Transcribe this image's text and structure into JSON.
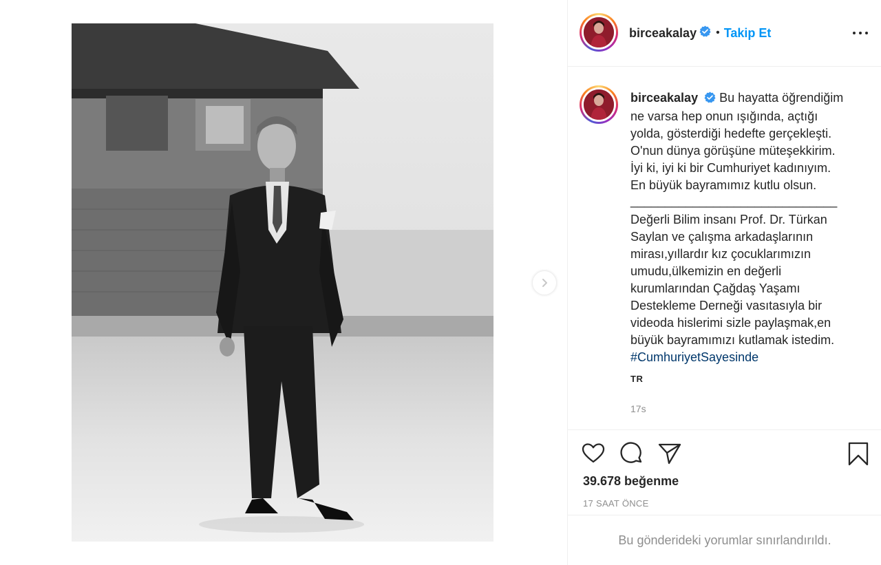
{
  "post": {
    "username": "birceakalay",
    "verified": true,
    "dot": "•",
    "follow_label": "Takip Et",
    "more_icon": "more-horizontal-icon"
  },
  "media": {
    "next_icon": "chevron-right-icon",
    "alt": "Black and white photograph"
  },
  "caption": {
    "username": "birceakalay",
    "lines": [
      "Bu hayatta öğrendiğim",
      "ne varsa hep onun ışığında, açtığı",
      "yolda, gösterdiği hedefte gerçekleşti.",
      "O'nun dünya görüşüne müteşekkirim.",
      "İyi ki, iyi ki bir Cumhuriyet kadınıyım.",
      "En büyük bayramımız kutlu olsun.",
      "______________________________",
      "Değerli Bilim insanı Prof. Dr. Türkan",
      "Saylan ve çalışma arkadaşlarının",
      "mirası,yıllardır kız çocuklarımızın",
      "umudu,ülkemizin en değerli",
      "kurumlarından Çağdaş Yaşamı",
      "Destekleme Derneği vasıtasıyla bir",
      "videoda hislerimi sizle paylaşmak,en",
      "büyük bayramımızı kutlamak istedim."
    ],
    "hashtag": "#CumhuriyetSayesinde",
    "translate": "TR",
    "time": "17s"
  },
  "actions": {
    "like_icon": "heart-icon",
    "comment_icon": "comment-icon",
    "share_icon": "send-icon",
    "save_icon": "bookmark-icon",
    "likes": "39.678 beğenme",
    "ago": "17 SAAT ÖNCE"
  },
  "comments": {
    "limited_notice": "Bu gönderideki yorumlar sınırlandırıldı."
  },
  "colors": {
    "accent": "#0095f6",
    "hashtag": "#00376b",
    "muted": "#8e8e8e",
    "text": "#262626",
    "verified": "#3897f0"
  }
}
